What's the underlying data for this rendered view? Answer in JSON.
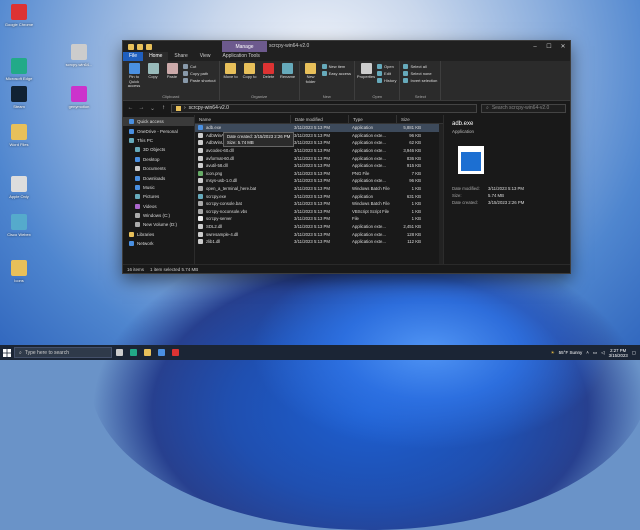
{
  "colors": {
    "accent": "#1f5fbf",
    "manage_tab": "#6d5a8e",
    "selection": "#3d4a5b",
    "folder": "#e8c05a"
  },
  "desktop_icons": [
    {
      "label": "Google Chrome",
      "icon": "chrome-icon",
      "color": "#d33"
    },
    {
      "label": "scrcpy-win64...",
      "icon": "folder-zip-icon",
      "color": "#ccc"
    },
    {
      "label": "Microsoft Edge",
      "icon": "edge-icon",
      "color": "#2a8"
    },
    {
      "label": "Steam",
      "icon": "steam-icon",
      "color": "#123"
    },
    {
      "label": "genymotion",
      "icon": "genymotion-icon",
      "color": "#c3c"
    },
    {
      "label": "Word Files",
      "icon": "folder-icon",
      "color": "#e8c05a"
    },
    {
      "label": "Apple Only",
      "icon": "app-icon",
      "color": "#ddd"
    },
    {
      "label": "Cisco Webex",
      "icon": "webex-icon",
      "color": "#5ac"
    },
    {
      "label": "Icons",
      "icon": "folder-icon",
      "color": "#e8c05a"
    }
  ],
  "window": {
    "title": "scrcpy-win64-v2.0",
    "manage": "Manage",
    "tabs": [
      "File",
      "Home",
      "Share",
      "View",
      "Application Tools"
    ],
    "ribbon": {
      "groups": [
        {
          "label": "Clipboard",
          "big": [
            {
              "label": "Pin to Quick access",
              "icon": "pin-icon",
              "color": "#4a90e2"
            },
            {
              "label": "Copy",
              "icon": "copy-icon",
              "color": "#9bb"
            },
            {
              "label": "Paste",
              "icon": "paste-icon",
              "color": "#caa"
            }
          ],
          "small": [
            {
              "label": "Cut",
              "icon": "cut-icon",
              "color": "#89a"
            },
            {
              "label": "Copy path",
              "icon": "copy-path-icon",
              "color": "#89a"
            },
            {
              "label": "Paste shortcut",
              "icon": "paste-shortcut-icon",
              "color": "#89a"
            }
          ]
        },
        {
          "label": "Organize",
          "big": [
            {
              "label": "Move to",
              "icon": "move-to-icon",
              "color": "#e8c05a"
            },
            {
              "label": "Copy to",
              "icon": "copy-to-icon",
              "color": "#e8c05a"
            },
            {
              "label": "Delete",
              "icon": "delete-icon",
              "color": "#d33"
            },
            {
              "label": "Rename",
              "icon": "rename-icon",
              "color": "#6ab"
            }
          ],
          "small": []
        },
        {
          "label": "New",
          "big": [
            {
              "label": "New folder",
              "icon": "new-folder-icon",
              "color": "#e8c05a"
            }
          ],
          "small": [
            {
              "label": "New item",
              "icon": "new-item-icon",
              "color": "#6ab"
            },
            {
              "label": "Easy access",
              "icon": "easy-access-icon",
              "color": "#6ab"
            }
          ]
        },
        {
          "label": "Open",
          "big": [
            {
              "label": "Properties",
              "icon": "properties-icon",
              "color": "#ccc"
            }
          ],
          "small": [
            {
              "label": "Open",
              "icon": "open-icon",
              "color": "#6ab"
            },
            {
              "label": "Edit",
              "icon": "edit-icon",
              "color": "#6ab"
            },
            {
              "label": "History",
              "icon": "history-icon",
              "color": "#6ab"
            }
          ]
        },
        {
          "label": "Select",
          "big": [],
          "small": [
            {
              "label": "Select all",
              "icon": "select-all-icon",
              "color": "#6ab"
            },
            {
              "label": "Select none",
              "icon": "select-none-icon",
              "color": "#6ab"
            },
            {
              "label": "Invert selection",
              "icon": "invert-selection-icon",
              "color": "#6ab"
            }
          ]
        }
      ]
    },
    "address": "scrcpy-win64-v2.0",
    "search_placeholder": "Search scrcpy-win64-v2.0",
    "nav": [
      {
        "label": "Quick access",
        "icon": "star-icon",
        "color": "#4a90e2",
        "indent": false,
        "selected": true
      },
      {
        "label": "OneDrive - Personal",
        "icon": "cloud-icon",
        "color": "#4a90e2",
        "indent": false
      },
      {
        "label": "This PC",
        "icon": "pc-icon",
        "color": "#6ab",
        "indent": false
      },
      {
        "label": "3D Objects",
        "icon": "cube-icon",
        "color": "#6ab",
        "indent": true
      },
      {
        "label": "Desktop",
        "icon": "desktop-icon",
        "color": "#4a90e2",
        "indent": true
      },
      {
        "label": "Documents",
        "icon": "documents-icon",
        "color": "#ccc",
        "indent": true
      },
      {
        "label": "Downloads",
        "icon": "downloads-icon",
        "color": "#4a90e2",
        "indent": true
      },
      {
        "label": "Music",
        "icon": "music-icon",
        "color": "#4a90e2",
        "indent": true
      },
      {
        "label": "Pictures",
        "icon": "pictures-icon",
        "color": "#6ab",
        "indent": true
      },
      {
        "label": "Videos",
        "icon": "videos-icon",
        "color": "#a6c",
        "indent": true
      },
      {
        "label": "Windows (C:)",
        "icon": "drive-icon",
        "color": "#aaa",
        "indent": true
      },
      {
        "label": "New Volume (D:)",
        "icon": "drive-icon",
        "color": "#aaa",
        "indent": true
      },
      {
        "label": "Libraries",
        "icon": "libraries-icon",
        "color": "#e8c05a",
        "indent": false
      },
      {
        "label": "Network",
        "icon": "network-icon",
        "color": "#4a90e2",
        "indent": false
      }
    ],
    "columns": [
      "Name",
      "Date modified",
      "Type",
      "Size"
    ],
    "files": [
      {
        "name": "adb.exe",
        "date": "3/11/2023 5:13 PM",
        "type": "Application",
        "size": "5,881 KB",
        "selected": true,
        "icon": "exe-icon",
        "color": "#4a90e2"
      },
      {
        "name": "AdbWinApi.dll",
        "date": "3/11/2023 5:13 PM",
        "type": "Application exte...",
        "size": "96 KB",
        "icon": "dll-icon",
        "color": "#ccc"
      },
      {
        "name": "AdbWinUsbApi.dll",
        "date": "3/11/2023 5:13 PM",
        "type": "Application exte...",
        "size": "62 KB",
        "icon": "dll-icon",
        "color": "#ccc"
      },
      {
        "name": "avcodec-60.dll",
        "date": "3/11/2023 5:13 PM",
        "type": "Application exte...",
        "size": "3,946 KB",
        "icon": "dll-icon",
        "color": "#ccc"
      },
      {
        "name": "avformat-60.dll",
        "date": "3/11/2023 5:13 PM",
        "type": "Application exte...",
        "size": "836 KB",
        "icon": "dll-icon",
        "color": "#ccc"
      },
      {
        "name": "avutil-58.dll",
        "date": "3/11/2023 5:13 PM",
        "type": "Application exte...",
        "size": "915 KB",
        "icon": "dll-icon",
        "color": "#ccc"
      },
      {
        "name": "icon.png",
        "date": "3/11/2023 5:13 PM",
        "type": "PNG File",
        "size": "7 KB",
        "icon": "png-icon",
        "color": "#6a6"
      },
      {
        "name": "msys-usb-1.0.dll",
        "date": "3/11/2023 5:13 PM",
        "type": "Application exte...",
        "size": "96 KB",
        "icon": "dll-icon",
        "color": "#ccc"
      },
      {
        "name": "open_a_terminal_here.bat",
        "date": "3/11/2023 5:13 PM",
        "type": "Windows Batch File",
        "size": "1 KB",
        "icon": "bat-icon",
        "color": "#aaa"
      },
      {
        "name": "scrcpy.exe",
        "date": "3/11/2023 5:13 PM",
        "type": "Application",
        "size": "631 KB",
        "icon": "exe-icon",
        "color": "#6ab"
      },
      {
        "name": "scrcpy-console.bat",
        "date": "3/11/2023 5:13 PM",
        "type": "Windows Batch File",
        "size": "1 KB",
        "icon": "bat-icon",
        "color": "#aaa"
      },
      {
        "name": "scrcpy-noconsole.vbs",
        "date": "3/11/2023 5:13 PM",
        "type": "VBScript Script File",
        "size": "1 KB",
        "icon": "vbs-icon",
        "color": "#aaa"
      },
      {
        "name": "scrcpy-server",
        "date": "3/11/2023 5:13 PM",
        "type": "File",
        "size": "1 KB",
        "icon": "file-icon",
        "color": "#eee"
      },
      {
        "name": "SDL2.dll",
        "date": "3/11/2023 5:13 PM",
        "type": "Application exte...",
        "size": "2,451 KB",
        "icon": "dll-icon",
        "color": "#ccc"
      },
      {
        "name": "swresample-4.dll",
        "date": "3/11/2023 5:13 PM",
        "type": "Application exte...",
        "size": "128 KB",
        "icon": "dll-icon",
        "color": "#ccc"
      },
      {
        "name": "zlib1.dll",
        "date": "3/11/2023 5:13 PM",
        "type": "Application exte...",
        "size": "112 KB",
        "icon": "dll-icon",
        "color": "#ccc"
      }
    ],
    "tooltip": {
      "line1": "Date created: 3/15/2023 2:26 PM",
      "line2": "Size: 5.74 MB"
    },
    "preview": {
      "name": "adb.exe",
      "type": "Application",
      "date_modified_label": "Date modified:",
      "date_modified": "3/11/2023 5:13 PM",
      "size_label": "Size:",
      "size": "5.74 MB",
      "date_created_label": "Date created:",
      "date_created": "3/15/2023 2:26 PM"
    },
    "status": {
      "items": "16 items",
      "selected": "1 item selected 5.74 MB"
    }
  },
  "taskbar": {
    "search_placeholder": "Type here to search",
    "apps": [
      {
        "icon": "task-view-icon",
        "color": "#ccc"
      },
      {
        "icon": "edge-icon",
        "color": "#2a8"
      },
      {
        "icon": "file-explorer-icon",
        "color": "#e8c05a"
      },
      {
        "icon": "store-icon",
        "color": "#4a90e2"
      },
      {
        "icon": "chrome-icon",
        "color": "#d33"
      }
    ],
    "weather": "55°F  Sunny",
    "time": "2:27 PM",
    "date": "3/15/2023"
  }
}
